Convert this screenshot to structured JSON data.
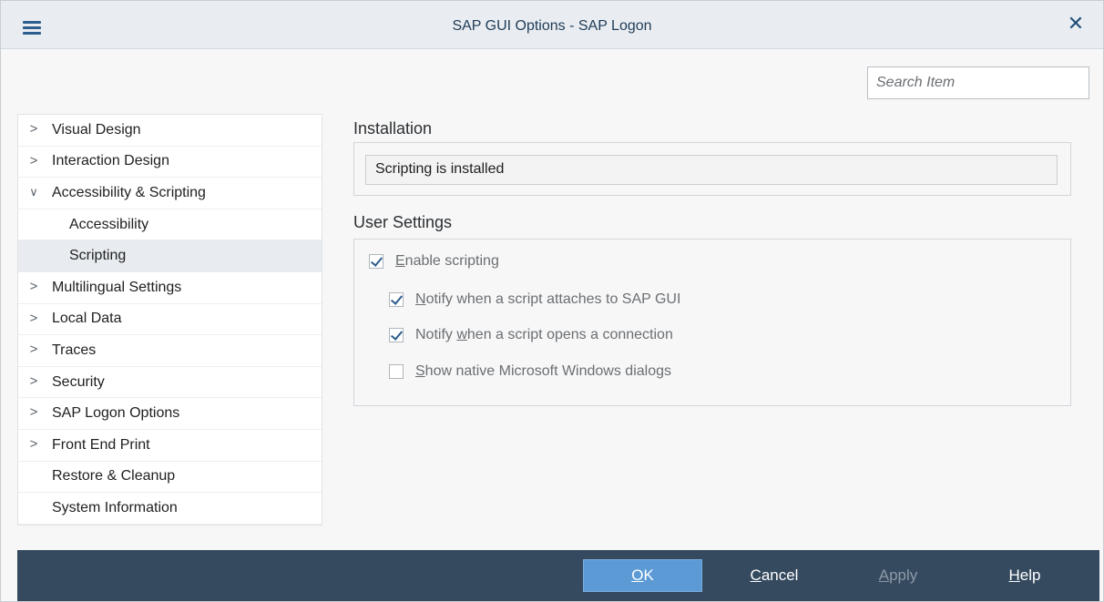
{
  "window": {
    "title": "SAP GUI Options - SAP Logon"
  },
  "search": {
    "placeholder": "Search Item"
  },
  "tree": {
    "items": [
      {
        "label": "Visual Design",
        "expandable": true,
        "expanded": false,
        "level": 0
      },
      {
        "label": "Interaction Design",
        "expandable": true,
        "expanded": false,
        "level": 0
      },
      {
        "label": "Accessibility & Scripting",
        "expandable": true,
        "expanded": true,
        "level": 0
      },
      {
        "label": "Accessibility",
        "expandable": false,
        "level": 1
      },
      {
        "label": "Scripting",
        "expandable": false,
        "level": 1,
        "selected": true
      },
      {
        "label": "Multilingual Settings",
        "expandable": true,
        "expanded": false,
        "level": 0
      },
      {
        "label": "Local Data",
        "expandable": true,
        "expanded": false,
        "level": 0
      },
      {
        "label": "Traces",
        "expandable": true,
        "expanded": false,
        "level": 0
      },
      {
        "label": "Security",
        "expandable": true,
        "expanded": false,
        "level": 0
      },
      {
        "label": "SAP Logon Options",
        "expandable": true,
        "expanded": false,
        "level": 0
      },
      {
        "label": "Front End Print",
        "expandable": true,
        "expanded": false,
        "level": 0
      },
      {
        "label": "Restore & Cleanup",
        "expandable": false,
        "level": 0
      },
      {
        "label": "System Information",
        "expandable": false,
        "level": 0
      }
    ]
  },
  "installation": {
    "title": "Installation",
    "status": "Scripting is installed"
  },
  "user_settings": {
    "title": "User Settings",
    "enable_scripting": {
      "label_u": "E",
      "label_rest": "nable scripting",
      "checked": true
    },
    "notify_attach": {
      "label_pre": "",
      "label_u": "N",
      "label_rest": "otify when a script attaches to SAP GUI",
      "checked": true
    },
    "notify_connection": {
      "label_pre": "Notify ",
      "label_u": "w",
      "label_rest": "hen a script opens a connection",
      "checked": true
    },
    "native_dialogs": {
      "label_pre": "",
      "label_u": "S",
      "label_rest": "how native Microsoft Windows dialogs",
      "checked": false
    }
  },
  "footer": {
    "ok": {
      "u": "O",
      "rest": "K"
    },
    "cancel": {
      "u": "C",
      "rest": "ancel"
    },
    "apply": {
      "u": "A",
      "rest": "pply"
    },
    "help": {
      "u": "H",
      "rest": "elp"
    }
  },
  "colors": {
    "titlebar_bg": "#e9edf2",
    "footer_bg": "#354a5f",
    "primary_button": "#5c9ad6",
    "selected_row": "#e8ecf0"
  },
  "icons": {
    "menu": "hamburger-menu-icon",
    "close": "close-icon",
    "collapsed": "chevron-right-icon",
    "expanded": "chevron-down-icon",
    "check": "checkmark-icon"
  }
}
